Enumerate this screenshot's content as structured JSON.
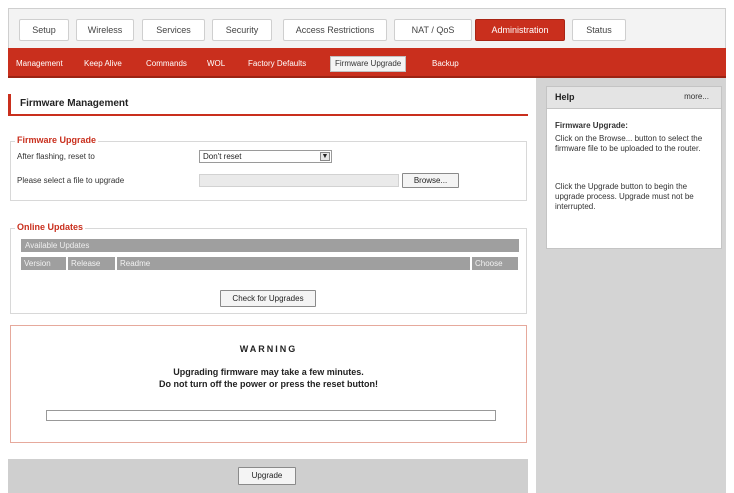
{
  "top_tabs": [
    "Setup",
    "Wireless",
    "Services",
    "Security",
    "Access Restrictions",
    "NAT / QoS",
    "Administration",
    "Status"
  ],
  "sub_tabs": [
    "Management",
    "Keep Alive",
    "Commands",
    "WOL",
    "Factory Defaults",
    "Firmware Upgrade",
    "Backup"
  ],
  "page_title": "Firmware Management",
  "firmware_upgrade": {
    "legend": "Firmware Upgrade",
    "reset_label": "After flashing, reset to",
    "reset_value": "Don't reset",
    "file_label": "Please select a file to upgrade",
    "browse_label": "Browse..."
  },
  "online_updates": {
    "legend": "Online Updates",
    "available_label": "Available Updates",
    "columns": [
      "Version",
      "Release",
      "Readme",
      "Choose"
    ],
    "check_label": "Check for Upgrades"
  },
  "warning": {
    "title": "WARNING",
    "line1": "Upgrading firmware may take a few minutes.",
    "line2": "Do not turn off the power or press the reset button!"
  },
  "upgrade_label": "Upgrade",
  "help": {
    "title": "Help",
    "more": "more...",
    "heading": "Firmware Upgrade:",
    "para1": "Click on the Browse... button to select the firmware file to be uploaded to the router.",
    "para2": "Click the Upgrade button to begin the upgrade process. Upgrade must not be interrupted."
  },
  "colors": {
    "accent": "#c92f1d",
    "panel": "#d4d4d4"
  }
}
